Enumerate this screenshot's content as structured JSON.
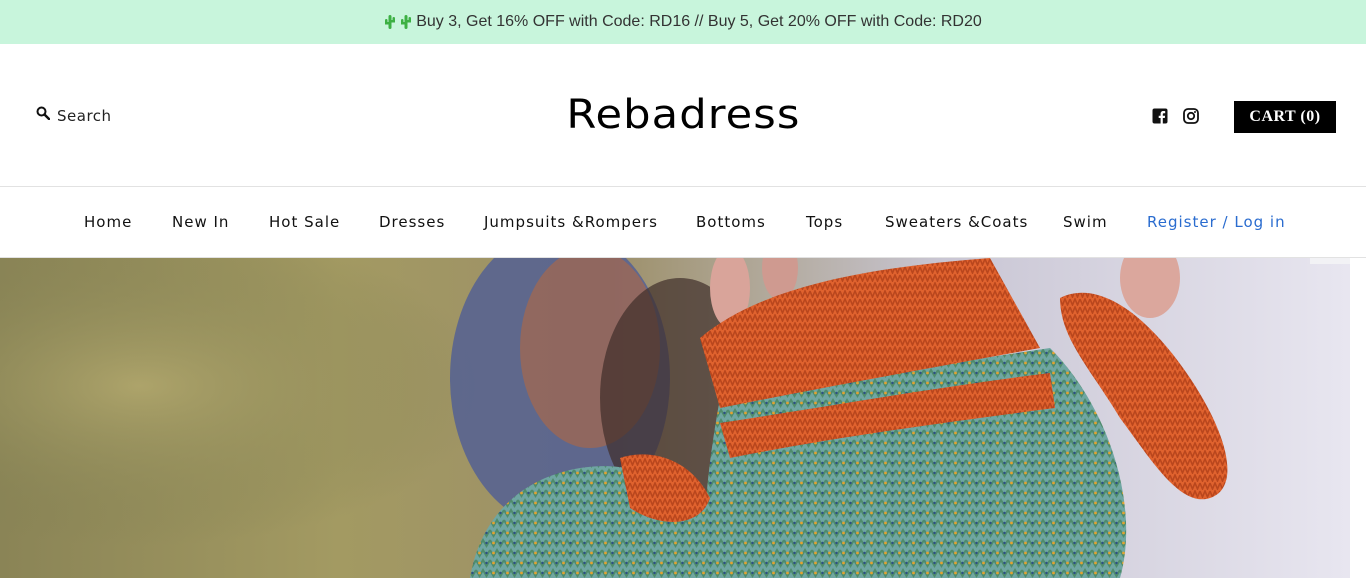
{
  "announcement": {
    "text": "Buy 3, Get 16% OFF with Code: RD16 // Buy 5, Get 20% OFF with Code: RD20",
    "icons": [
      "cactus-icon",
      "cactus-icon"
    ],
    "background": "#c8f5dc"
  },
  "header": {
    "search_label": "Search",
    "logo": "Rebadress",
    "social": [
      "facebook-icon",
      "instagram-icon"
    ],
    "cart_label": "CART (0)"
  },
  "nav": {
    "items": [
      "Home",
      "New In",
      "Hot Sale",
      "Dresses",
      "Jumpsuits &Rompers",
      "Bottoms",
      "Tops",
      "Sweaters &Coats",
      "Swim"
    ],
    "login": "Register / Log in",
    "login_color": "#2a6ccf"
  },
  "hero": {
    "image": "knitted-mittens-photo"
  }
}
